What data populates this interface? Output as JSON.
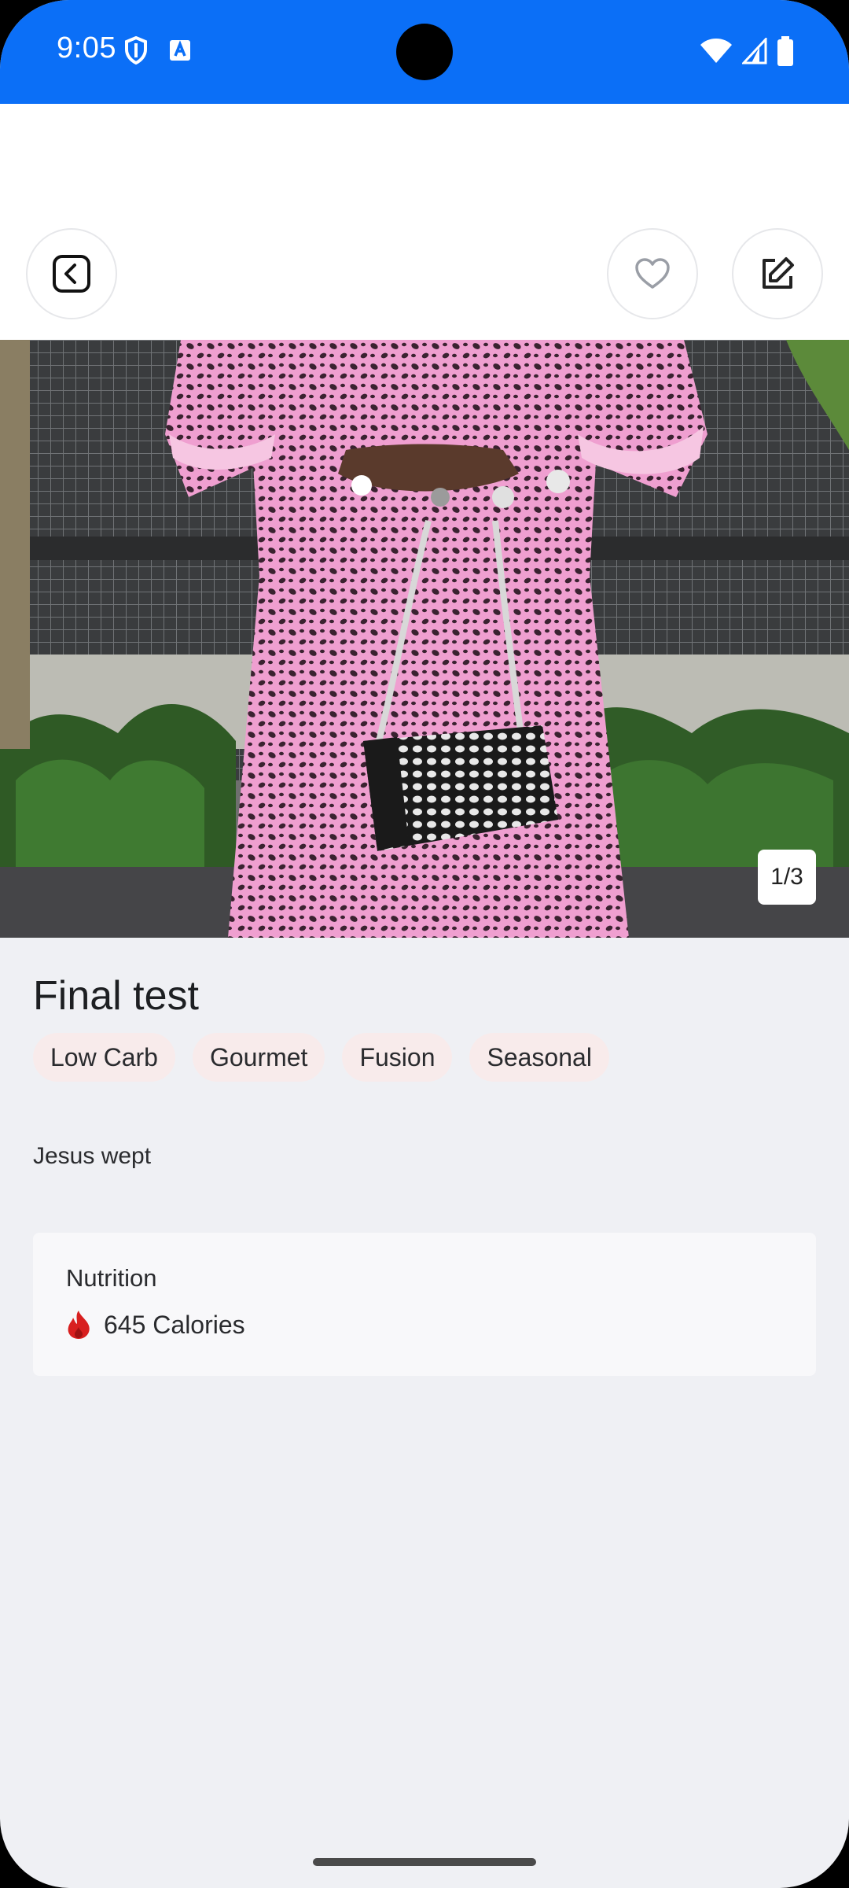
{
  "status_bar": {
    "time": "9:05",
    "icons": [
      "vpn-shield-icon",
      "keyboard-a-icon",
      "wifi-icon",
      "cellular-signal-icon",
      "battery-icon"
    ]
  },
  "header": {
    "back_icon": "chevron-left-icon",
    "favorite_icon": "heart-icon",
    "edit_icon": "edit-icon"
  },
  "hero": {
    "image_counter": "1/3"
  },
  "recipe": {
    "title": "Final test",
    "tags": [
      "Low Carb",
      "Gourmet",
      "Fusion",
      "Seasonal"
    ],
    "description": "Jesus wept",
    "nutrition": {
      "label": "Nutrition",
      "calories_text": "645 Calories",
      "calories_icon": "flame-icon"
    }
  },
  "colors": {
    "status_bar": "#0b6ff7",
    "background": "#eff0f4",
    "tag_bg": "#f8ebeb",
    "flame": "#d81f1f"
  }
}
